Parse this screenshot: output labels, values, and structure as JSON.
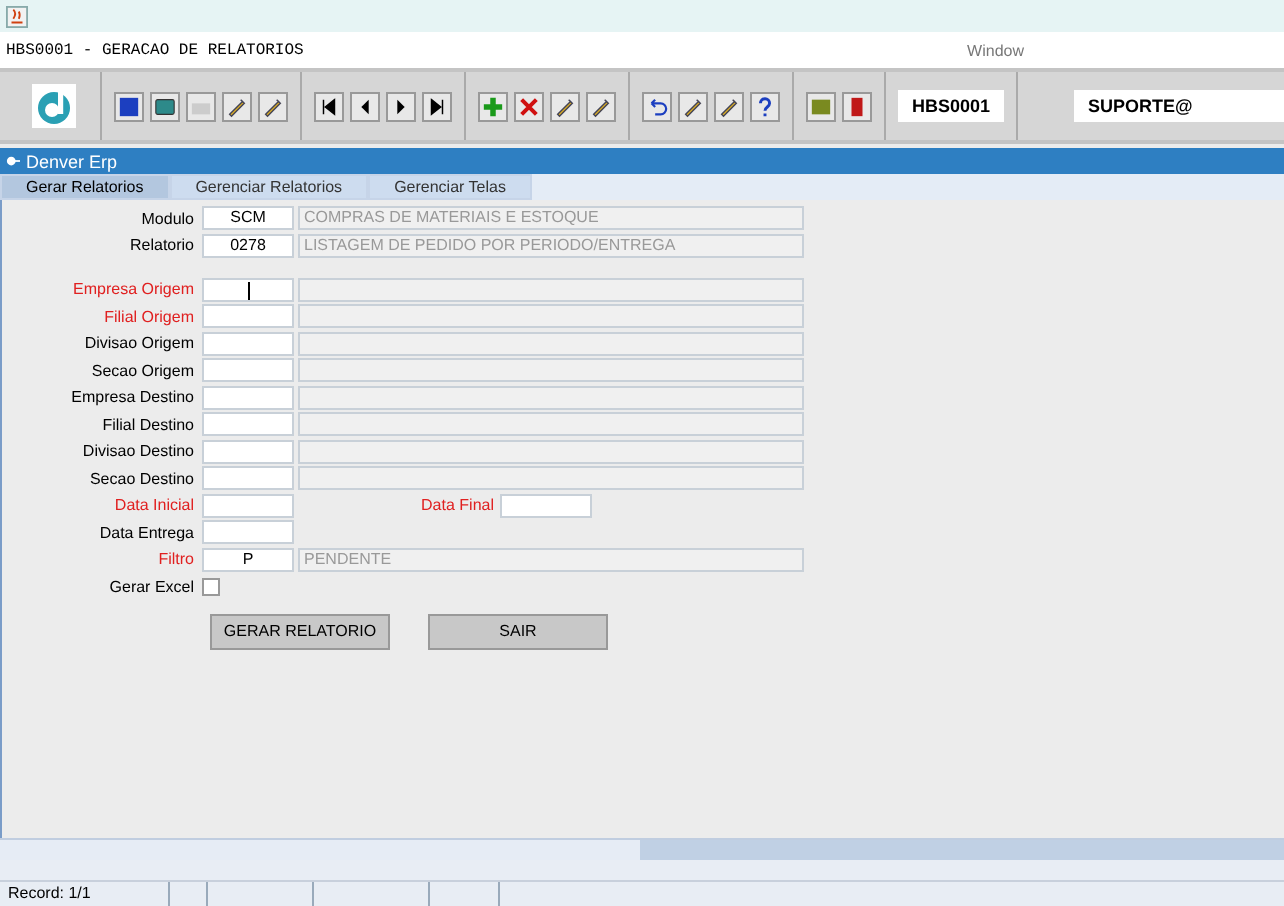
{
  "window": {
    "title": "HBS0001 - GERACAO DE RELATORIOS",
    "menu": "Window"
  },
  "toolbar": {
    "program": "HBS0001",
    "user": "SUPORTE@"
  },
  "frame": {
    "title": "Denver Erp"
  },
  "tabs": [
    {
      "label": "Gerar Relatorios",
      "selected": true
    },
    {
      "label": "Gerenciar Relatorios",
      "selected": false
    },
    {
      "label": "Gerenciar Telas",
      "selected": false
    }
  ],
  "header": [
    {
      "label": "Modulo",
      "code": "SCM",
      "description": "COMPRAS DE MATERIAIS E ESTOQUE"
    },
    {
      "label": "Relatorio",
      "code": "0278",
      "description": "LISTAGEM DE PEDIDO POR PERIODO/ENTREGA"
    }
  ],
  "fields": [
    {
      "kind": "lookup",
      "label": "Empresa Origem",
      "required": true,
      "focused": true
    },
    {
      "kind": "lookup",
      "label": "Filial Origem",
      "required": true,
      "focused": false
    },
    {
      "kind": "lookup",
      "label": "Divisao Origem",
      "required": false,
      "focused": false
    },
    {
      "kind": "lookup",
      "label": "Secao Origem",
      "required": false,
      "focused": false
    },
    {
      "kind": "lookup",
      "label": "Empresa Destino",
      "required": false,
      "focused": false
    },
    {
      "kind": "lookup",
      "label": "Filial Destino",
      "required": false,
      "focused": false
    },
    {
      "kind": "lookup",
      "label": "Divisao Destino",
      "required": false,
      "focused": false
    },
    {
      "kind": "lookup",
      "label": "Secao Destino",
      "required": false,
      "focused": false
    },
    {
      "kind": "range",
      "label": "Data Inicial",
      "required": true,
      "focused": false,
      "second_label": "Data Final",
      "second_required": true
    },
    {
      "kind": "single",
      "label": "Data Entrega",
      "required": false,
      "focused": false
    },
    {
      "kind": "lookup",
      "label": "Filtro",
      "required": true,
      "focused": false,
      "code": "P",
      "description": "PENDENTE"
    },
    {
      "kind": "checkbox",
      "label": "Gerar Excel",
      "checked": false
    }
  ],
  "buttons": [
    "GERAR RELATORIO",
    "SAIR"
  ],
  "status_bar": {
    "record": "Record: 1/1"
  }
}
